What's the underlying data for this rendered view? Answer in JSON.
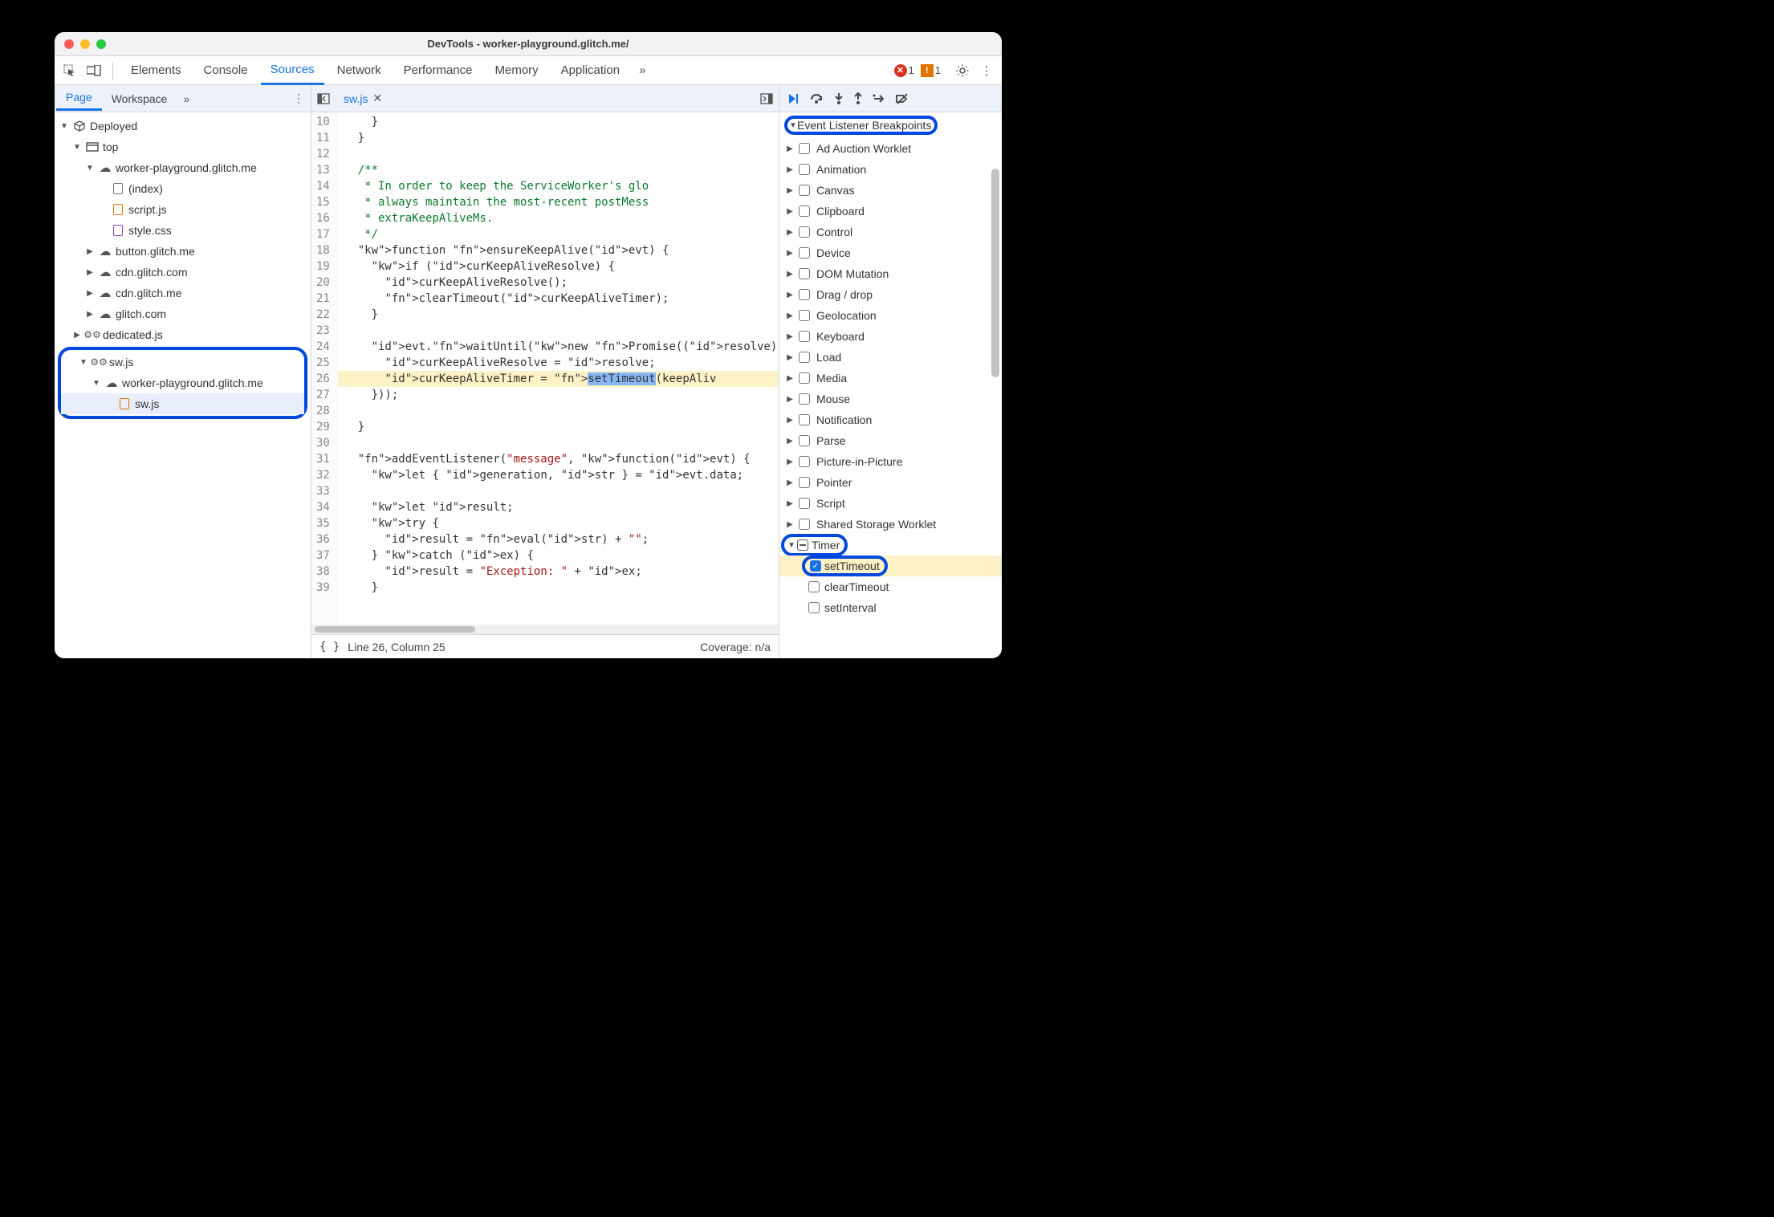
{
  "window": {
    "title": "DevTools - worker-playground.glitch.me/"
  },
  "main_tabs": {
    "items": [
      "Elements",
      "Console",
      "Sources",
      "Network",
      "Performance",
      "Memory",
      "Application"
    ],
    "active": "Sources"
  },
  "toolbar_right": {
    "error_count": "1",
    "warning_count": "1"
  },
  "left": {
    "tabs": [
      "Page",
      "Workspace"
    ],
    "active": "Page",
    "tree": {
      "root": "Deployed",
      "top": "top",
      "origin1": "worker-playground.glitch.me",
      "files1": [
        "(index)",
        "script.js",
        "style.css"
      ],
      "origins_more": [
        "button.glitch.me",
        "cdn.glitch.com",
        "cdn.glitch.me",
        "glitch.com"
      ],
      "dedicated": "dedicated.js",
      "sw_root": "sw.js",
      "sw_origin": "worker-playground.glitch.me",
      "sw_file": "sw.js"
    }
  },
  "editor": {
    "file_tab": "sw.js",
    "first_line": 10,
    "lines": [
      "    }",
      "  }",
      "",
      "  /**",
      "   * In order to keep the ServiceWorker's glo",
      "   * always maintain the most-recent postMess",
      "   * extraKeepAliveMs.",
      "   */",
      "  function ensureKeepAlive(evt) {",
      "    if (curKeepAliveResolve) {",
      "      curKeepAliveResolve();",
      "      clearTimeout(curKeepAliveTimer);",
      "    }",
      "",
      "    evt.waitUntil(new Promise((resolve) => {",
      "      curKeepAliveResolve = resolve;",
      "      curKeepAliveTimer = setTimeout(keepAliv",
      "    }));",
      "",
      "  }",
      "",
      "  addEventListener(\"message\", function(evt) {",
      "    let { generation, str } = evt.data;",
      "",
      "    let result;",
      "    try {",
      "      result = eval(str) + \"\";",
      "    } catch (ex) {",
      "      result = \"Exception: \" + ex;",
      "    }"
    ],
    "status_line": "Line 26, Column 25",
    "coverage": "Coverage: n/a"
  },
  "right": {
    "section_title": "Event Listener Breakpoints",
    "categories": [
      "Ad Auction Worklet",
      "Animation",
      "Canvas",
      "Clipboard",
      "Control",
      "Device",
      "DOM Mutation",
      "Drag / drop",
      "Geolocation",
      "Keyboard",
      "Load",
      "Media",
      "Mouse",
      "Notification",
      "Parse",
      "Picture-in-Picture",
      "Pointer",
      "Script",
      "Shared Storage Worklet"
    ],
    "timer": {
      "label": "Timer",
      "children": [
        "setTimeout",
        "clearTimeout",
        "setInterval"
      ],
      "checked": "setTimeout"
    }
  }
}
